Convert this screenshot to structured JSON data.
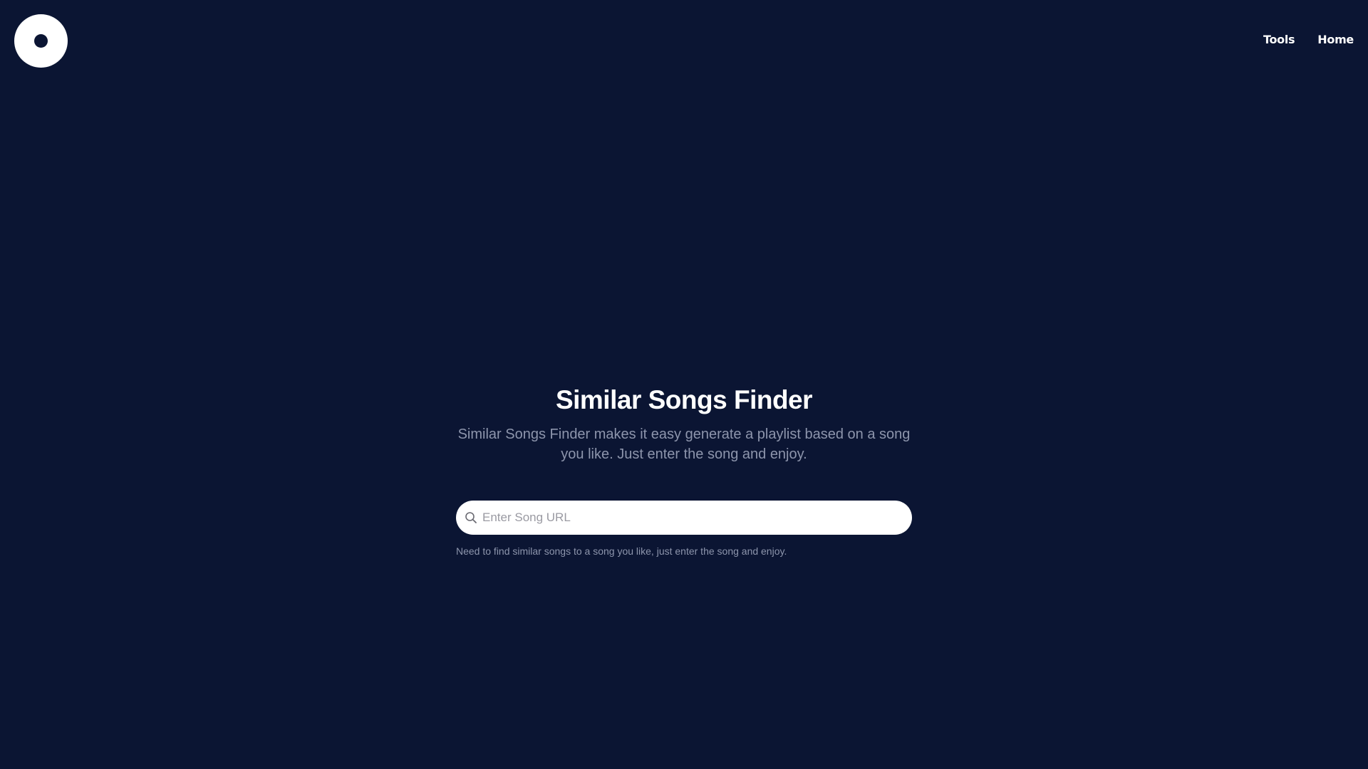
{
  "header": {
    "nav": {
      "tools_label": "Tools",
      "home_label": "Home"
    }
  },
  "hero": {
    "title": "Similar Songs Finder",
    "description": "Similar Songs Finder makes it easy generate a playlist based on a song you like. Just enter the song and enjoy."
  },
  "search": {
    "icon": "search-icon",
    "placeholder": "Enter Song URL",
    "value": "",
    "helper_text": "Need to find similar songs to a song you like, just enter the song and enjoy."
  },
  "colors": {
    "background": "#0b1533",
    "text_primary": "#ffffff",
    "text_muted": "#8d95ac"
  }
}
